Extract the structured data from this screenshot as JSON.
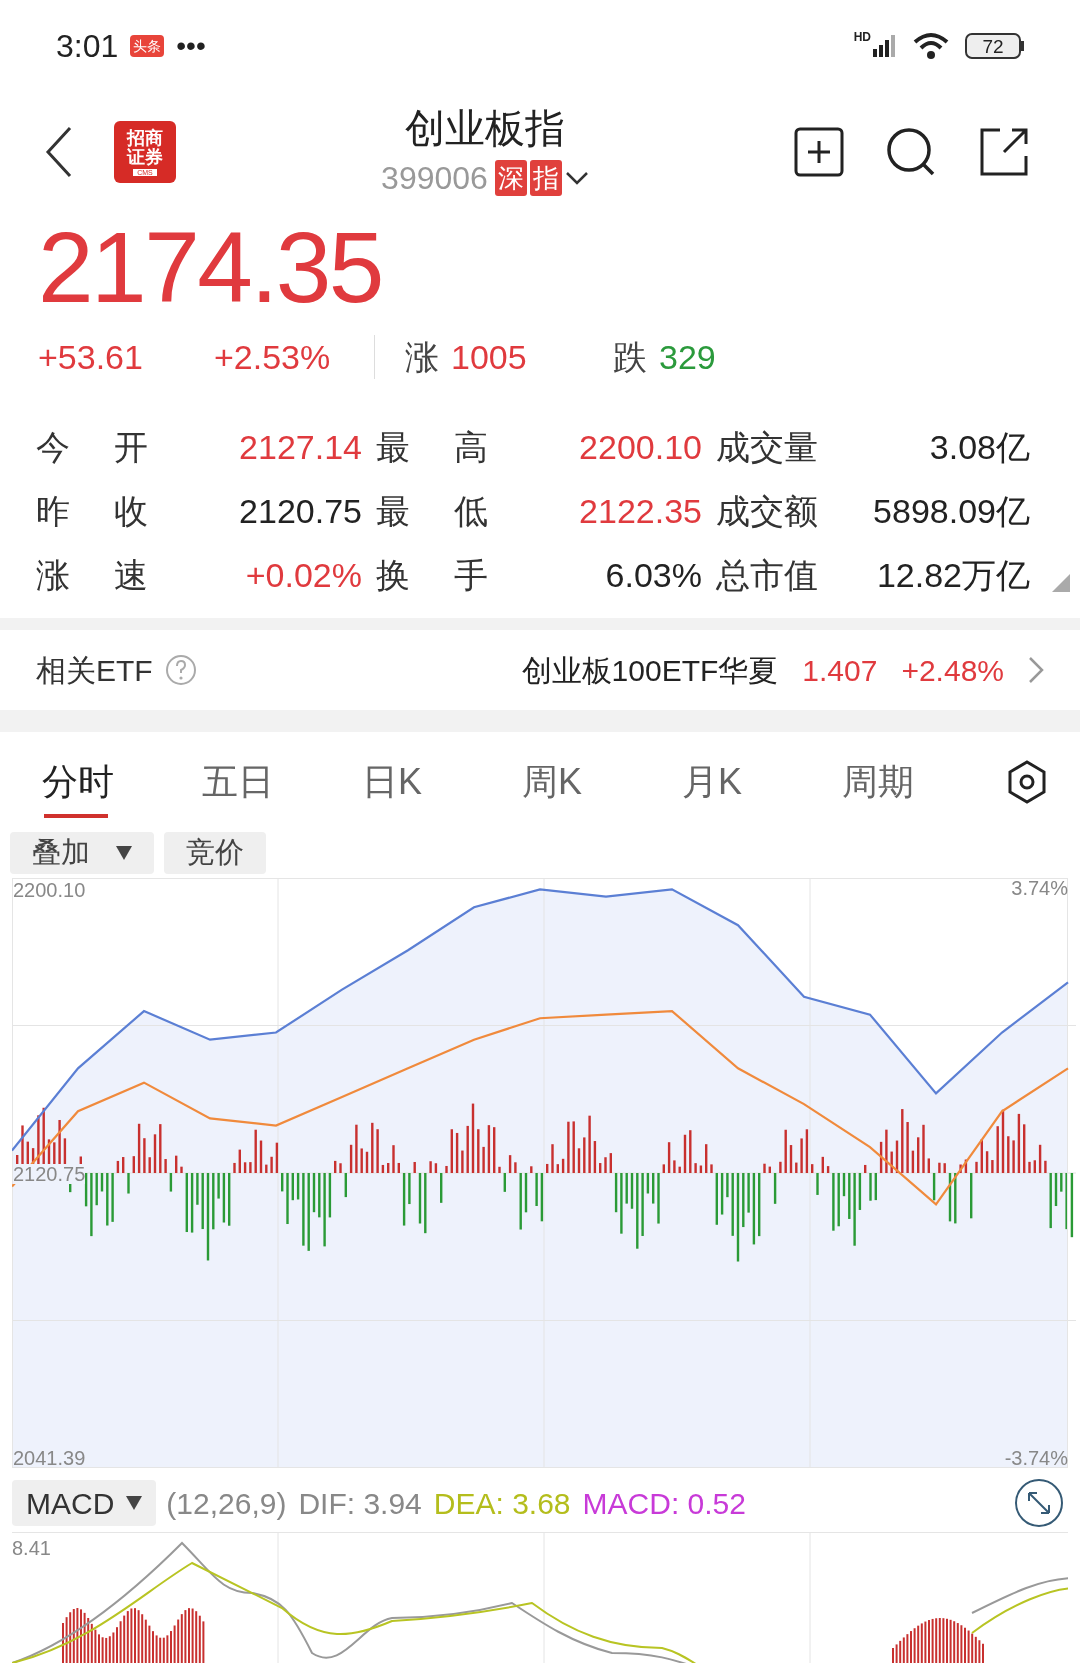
{
  "status_bar": {
    "time": "3:01",
    "notification_badge": "头条",
    "more": "•••",
    "network": "HD",
    "battery": "72"
  },
  "header": {
    "broker_logo": {
      "name": "招商证券",
      "sub": "CMS"
    },
    "title": "创业板指",
    "code": "399006",
    "tags": [
      "深",
      "指"
    ]
  },
  "quote": {
    "price": "2174.35",
    "change": "+53.61",
    "change_pct": "+2.53%",
    "rise_label": "涨",
    "rise_count": "1005",
    "fall_label": "跌",
    "fall_count": "329"
  },
  "stats": [
    {
      "label": "今开",
      "value": "2127.14",
      "color": "#e03a3e"
    },
    {
      "label": "最高",
      "value": "2200.10",
      "color": "#e03a3e"
    },
    {
      "label": "成交量",
      "value": "3.08亿",
      "color": "#222222"
    },
    {
      "label": "昨收",
      "value": "2120.75",
      "color": "#222222"
    },
    {
      "label": "最低",
      "value": "2122.35",
      "color": "#e03a3e"
    },
    {
      "label": "成交额",
      "value": "5898.09亿",
      "color": "#222222"
    },
    {
      "label": "涨速",
      "value": "+0.02%",
      "color": "#e03a3e"
    },
    {
      "label": "换手",
      "value": "6.03%",
      "color": "#222222"
    },
    {
      "label": "总市值",
      "value": "12.82万亿",
      "color": "#222222"
    }
  ],
  "etf": {
    "label": "相关ETF",
    "name": "创业板100ETF华夏",
    "price": "1.407",
    "change_pct": "+2.48%"
  },
  "tabs": [
    {
      "label": "分时",
      "selected": true
    },
    {
      "label": "五日",
      "selected": false
    },
    {
      "label": "日K",
      "selected": false
    },
    {
      "label": "周K",
      "selected": false
    },
    {
      "label": "月K",
      "selected": false
    },
    {
      "label": "周期",
      "selected": false
    }
  ],
  "chart_buttons": [
    {
      "label": "叠加",
      "dropdown": true
    },
    {
      "label": "竞价",
      "dropdown": false
    }
  ],
  "intraday": {
    "right_labels": [
      "3.74%",
      "-3.74%"
    ],
    "chart_data": {
      "type": "line",
      "grid": true,
      "ylim": [
        2038.6,
        2202.9
      ],
      "yticks": [
        {
          "value": 2200.1,
          "label": "2200.10"
        },
        {
          "value": 2120.75,
          "label": "2120.75"
        },
        {
          "value": 2041.39,
          "label": "2041.39"
        }
      ],
      "series": [
        {
          "color": "#5b7fd4",
          "values": [
            2127,
            2150,
            2166,
            2158,
            2160,
            2172,
            2183,
            2195,
            2200,
            2198,
            2200,
            2190,
            2170,
            2165,
            2143,
            2160,
            2174
          ]
        },
        {
          "color": "#f08a3c",
          "values": [
            2117,
            2138,
            2146,
            2136,
            2134,
            2142,
            2150,
            2158,
            2164,
            2165,
            2166,
            2150,
            2140,
            2128,
            2112,
            2138,
            2150
          ]
        }
      ]
    }
  },
  "macd": {
    "button": "MACD",
    "params": "(12,26,9)",
    "dif": "DIF: 3.94",
    "dea": "DEA: 3.68",
    "macd": "MACD: 0.52",
    "top_label": "8.41"
  }
}
